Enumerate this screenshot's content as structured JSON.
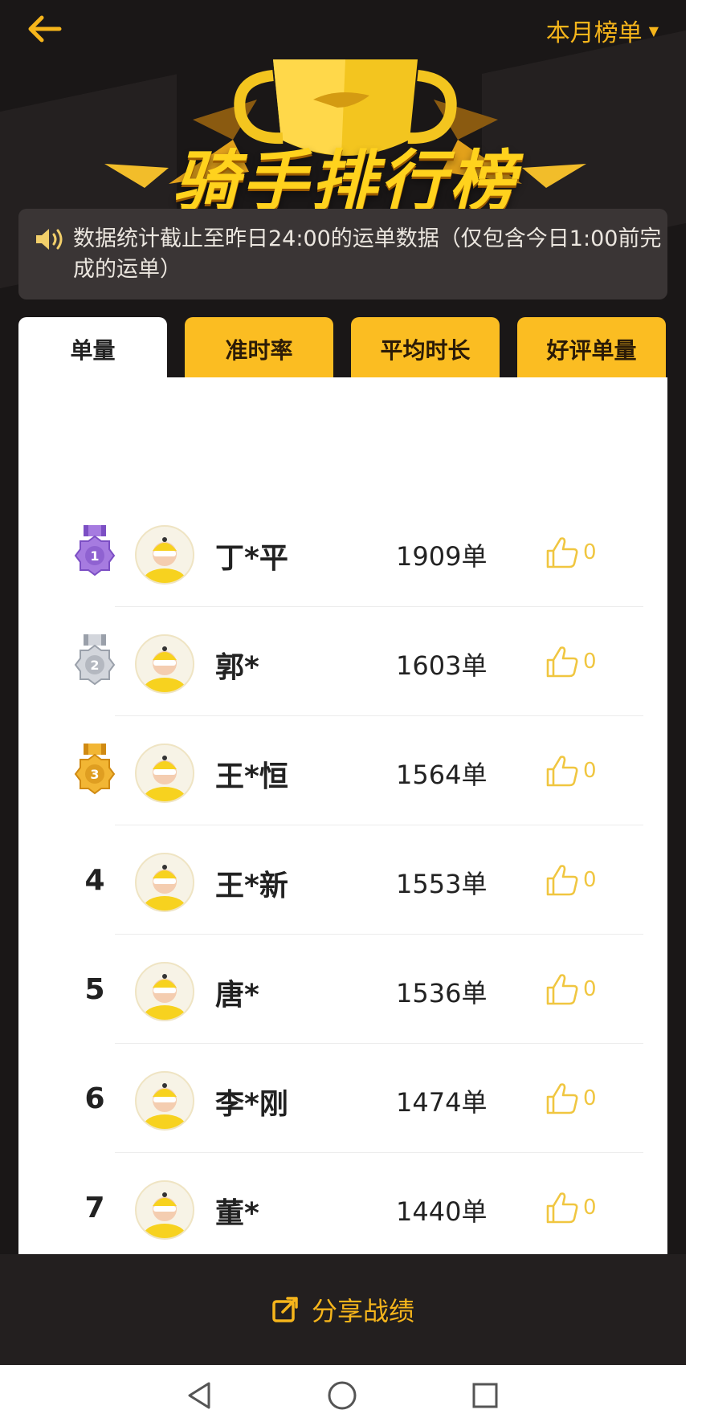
{
  "header": {
    "back_icon": "arrow-left-icon",
    "filter_label": "本月榜单",
    "filter_icon": "caret-down-icon"
  },
  "hero": {
    "title": "骑手排行榜"
  },
  "notice": {
    "icon": "speaker-icon",
    "text": "数据统计截止至昨日24:00的运单数据（仅包含今日1:00前完成的运单）"
  },
  "tabs": [
    {
      "label": "单量",
      "active": true
    },
    {
      "label": "准时率",
      "active": false
    },
    {
      "label": "平均时长",
      "active": false
    },
    {
      "label": "好评单量",
      "active": false
    }
  ],
  "ranking": [
    {
      "rank": "1",
      "medal": "purple",
      "name": "丁*平",
      "orders": "1909单",
      "likes": "0"
    },
    {
      "rank": "2",
      "medal": "silver",
      "name": "郭*",
      "orders": "1603单",
      "likes": "0"
    },
    {
      "rank": "3",
      "medal": "bronze",
      "name": "王*恒",
      "orders": "1564单",
      "likes": "0"
    },
    {
      "rank": "4",
      "medal": "",
      "name": "王*新",
      "orders": "1553单",
      "likes": "0"
    },
    {
      "rank": "5",
      "medal": "",
      "name": "唐*",
      "orders": "1536单",
      "likes": "0"
    },
    {
      "rank": "6",
      "medal": "",
      "name": "李*刚",
      "orders": "1474单",
      "likes": "0"
    },
    {
      "rank": "7",
      "medal": "",
      "name": "董*",
      "orders": "1440单",
      "likes": "0"
    }
  ],
  "share": {
    "icon": "share-icon",
    "label": "分享战绩"
  },
  "colors": {
    "accent": "#f6b51b",
    "tab": "#fbbd22",
    "background": "#1a1717",
    "like": "#f0c640"
  },
  "nav": {
    "back_icon": "nav-back-icon",
    "home_icon": "nav-home-icon",
    "recent_icon": "nav-recents-icon"
  }
}
